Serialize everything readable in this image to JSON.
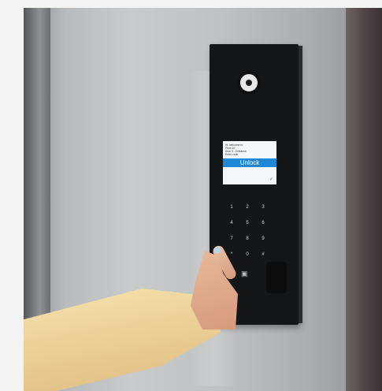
{
  "intercom": {
    "screen_lines": [
      "Hi, welcome to",
      "Floor 10",
      "Door 3 - Entrance",
      "Enter code"
    ],
    "unlock_label": "Unlock",
    "keys": [
      "1",
      "2",
      "3",
      "4",
      "5",
      "6",
      "7",
      "8",
      "9",
      "*",
      "0",
      "#"
    ],
    "screen_check_icon": "checkmark-icon",
    "reader_icon": "card-reader-icon"
  },
  "colors": {
    "panel": "#151617",
    "unlock_bar": "#1e88d6",
    "sleeve": "#f6e2ad"
  }
}
